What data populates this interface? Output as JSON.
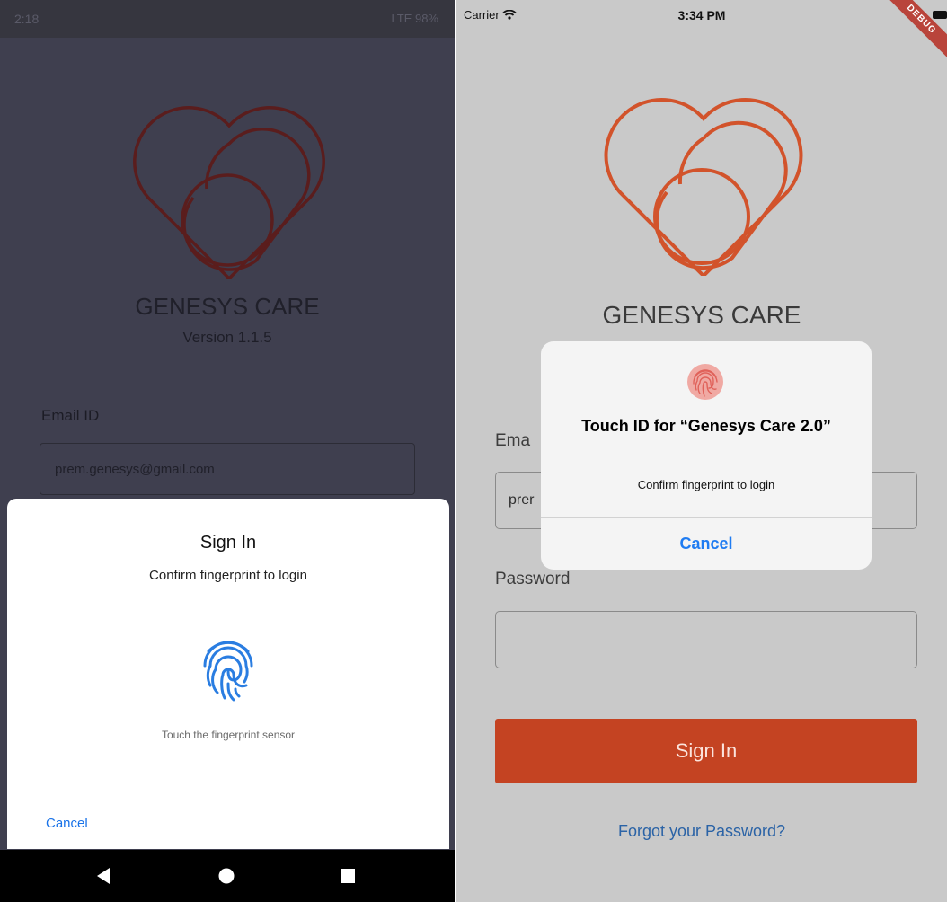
{
  "android": {
    "status": {
      "time": "2:18",
      "right": "LTE 98%"
    },
    "app_title": "GENESYS CARE",
    "version": "Version 1.1.5",
    "email_label": "Email ID",
    "email_value": "prem.genesys@gmail.com",
    "dialog": {
      "title": "Sign In",
      "subtitle": "Confirm fingerprint to login",
      "hint": "Touch the fingerprint sensor",
      "cancel": "Cancel"
    },
    "nav": [
      "back-icon",
      "home-icon",
      "recents-icon"
    ]
  },
  "ios": {
    "status": {
      "carrier": "Carrier",
      "time": "3:34 PM"
    },
    "debug_banner": "DEBUG",
    "app_title": "GENESYS CARE",
    "email_label": "Ema",
    "email_value": "prer",
    "password_label": "Password",
    "signin_label": "Sign In",
    "forgot_label": "Forgot your Password?",
    "alert": {
      "title": "Touch ID for “Genesys Care 2.0”",
      "message": "Confirm fingerprint to login",
      "cancel": "Cancel"
    }
  },
  "colors": {
    "android_bg": "#3f3f4f",
    "android_logo": "#5a1d1d",
    "android_accent": "#1a73e8",
    "ios_bg": "#c9c9c9",
    "ios_logo": "#d2532b",
    "ios_signin": "#c44322",
    "ios_link": "#2b63a6"
  }
}
